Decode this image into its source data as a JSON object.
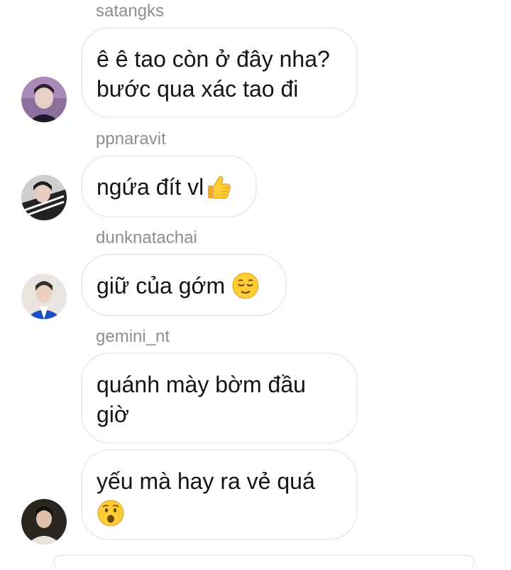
{
  "messages": [
    {
      "sender": "satangks",
      "text": "ê ê tao còn ở đây nha?\nbước qua xác tao đi",
      "emoji": null,
      "avatar": "avatar-satangks"
    },
    {
      "sender": "ppnaravit",
      "text": "ngứa đít vl",
      "emoji": "thumbs-up-icon",
      "avatar": "avatar-ppnaravit"
    },
    {
      "sender": "dunknatachai",
      "text": "giữ của gớm ",
      "emoji": "relieved-face-icon",
      "avatar": "avatar-dunknatachai"
    },
    {
      "sender": "gemini_nt",
      "text": "quánh mày bờm đầu\ngiờ",
      "emoji": null,
      "avatar": null
    },
    {
      "sender": null,
      "text": "yếu mà hay ra vẻ quá\n",
      "emoji": "surprised-face-icon",
      "avatar": "avatar-last"
    }
  ],
  "colors": {
    "sender": "#8e8e8e",
    "bubble_border": "#ececec",
    "text": "#141414",
    "emoji_yellow": "#ffcc33"
  }
}
